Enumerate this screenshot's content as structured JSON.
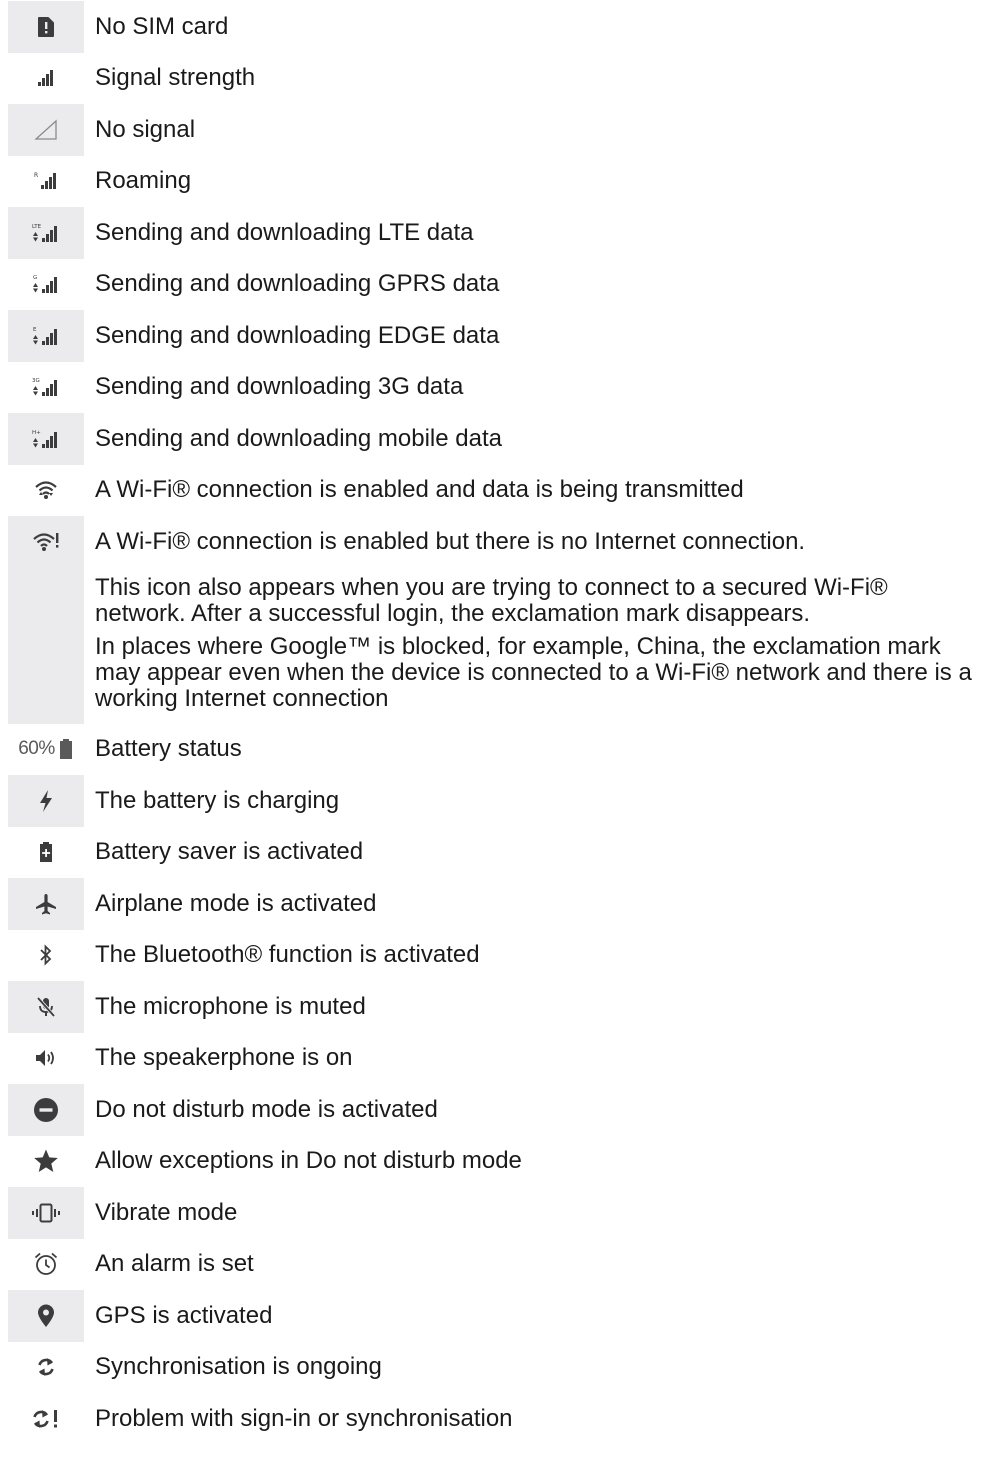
{
  "rows": [
    {
      "icon": "no-sim-card-icon",
      "text": "No SIM card"
    },
    {
      "icon": "signal-strength-icon",
      "text": "Signal strength"
    },
    {
      "icon": "no-signal-icon",
      "text": "No signal"
    },
    {
      "icon": "roaming-icon",
      "text": "Roaming",
      "badge": "R"
    },
    {
      "icon": "lte-data-icon",
      "text": "Sending and downloading LTE data",
      "badge": "LTE"
    },
    {
      "icon": "gprs-data-icon",
      "text": "Sending and downloading GPRS data",
      "badge": "G"
    },
    {
      "icon": "edge-data-icon",
      "text": "Sending and downloading EDGE data",
      "badge": "E"
    },
    {
      "icon": "3g-data-icon",
      "text": "Sending and downloading 3G data",
      "badge": "3G"
    },
    {
      "icon": "mobile-data-icon",
      "text": "Sending and downloading mobile data",
      "badge": "H+"
    },
    {
      "icon": "wifi-transmitting-icon",
      "text": "A Wi-Fi® connection is enabled and data is being transmitted"
    },
    {
      "icon": "wifi-no-internet-icon",
      "text": "A Wi-Fi® connection is enabled but there is no Internet connection.",
      "para2": "This icon also appears when you are trying to connect to a secured Wi-Fi® network. After a successful login, the exclamation mark disappears.",
      "para3": "In places where Google™ is blocked, for example, China, the exclamation mark may appear even when the device is connected to a Wi-Fi® network and there is a working Internet connection"
    },
    {
      "icon": "battery-status-icon",
      "text": "Battery status",
      "icon_label": "60%"
    },
    {
      "icon": "battery-charging-icon",
      "text": "The battery is charging"
    },
    {
      "icon": "battery-saver-icon",
      "text": "Battery saver is activated"
    },
    {
      "icon": "airplane-icon",
      "text": "Airplane mode is activated"
    },
    {
      "icon": "bluetooth-icon",
      "text": "The Bluetooth® function is activated"
    },
    {
      "icon": "microphone-muted-icon",
      "text": "The microphone is muted"
    },
    {
      "icon": "speakerphone-icon",
      "text": "The speakerphone is on"
    },
    {
      "icon": "do-not-disturb-icon",
      "text": "Do not disturb mode is activated"
    },
    {
      "icon": "star-icon",
      "text": "Allow exceptions in Do not disturb mode"
    },
    {
      "icon": "vibrate-icon",
      "text": "Vibrate mode"
    },
    {
      "icon": "alarm-icon",
      "text": "An alarm is set"
    },
    {
      "icon": "gps-icon",
      "text": "GPS is activated"
    },
    {
      "icon": "sync-icon",
      "text": "Synchronisation is ongoing"
    },
    {
      "icon": "sync-problem-icon",
      "text": "Problem with sign-in or synchronisation"
    }
  ],
  "colors": {
    "icon_bg": "#ebebed",
    "icon": "#3c3c3c",
    "text": "#1a1a1a"
  }
}
